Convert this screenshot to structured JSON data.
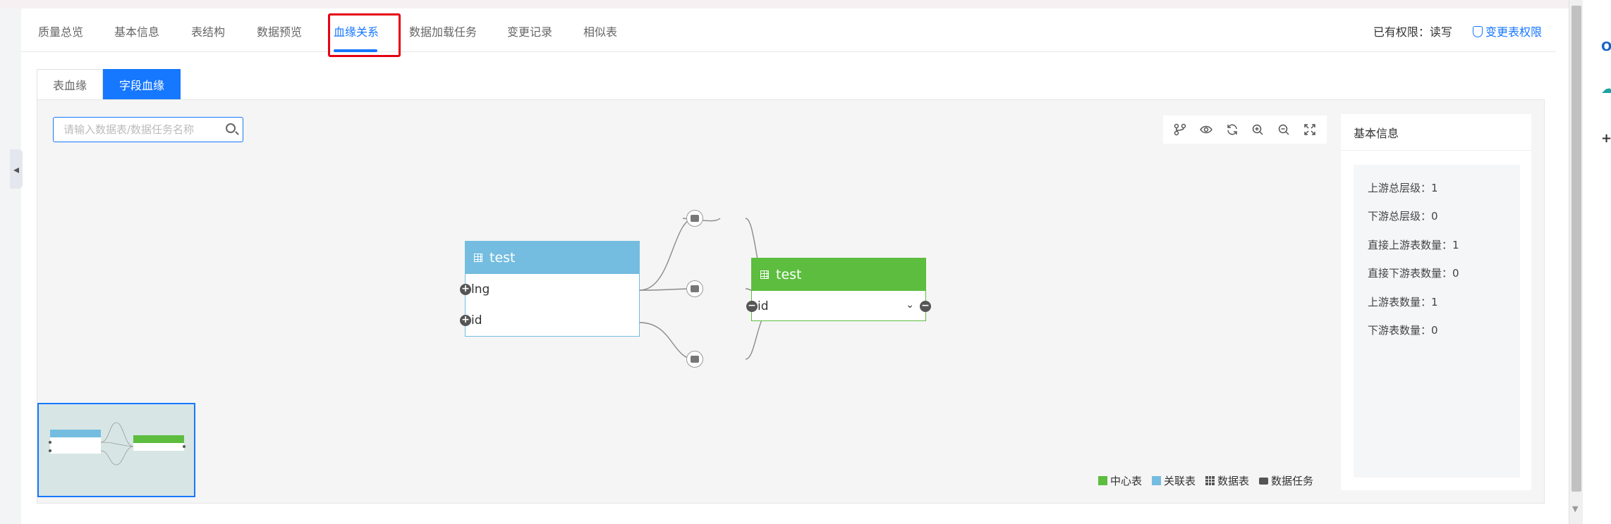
{
  "tabs": [
    "质量总览",
    "基本信息",
    "表结构",
    "数据预览",
    "血缘关系",
    "数据加载任务",
    "变更记录",
    "相似表"
  ],
  "active_tab_index": 4,
  "permission": {
    "label": "已有权限：读写",
    "link": "变更表权限",
    "icon": "shield-icon"
  },
  "subtabs": [
    "表血缘",
    "字段血缘"
  ],
  "active_subtab_index": 1,
  "search": {
    "placeholder": "请输入数据表/数据任务名称",
    "value": ""
  },
  "toolbar_icons": [
    "branch-icon",
    "eye-icon",
    "refresh-icon",
    "zoom-in-icon",
    "zoom-out-icon",
    "fullscreen-icon"
  ],
  "graph": {
    "source_table": {
      "name": "test",
      "fields": [
        "lng",
        "id"
      ],
      "color": "#74bde0"
    },
    "target_table": {
      "name": "test",
      "fields": [
        "id"
      ],
      "color": "#5cbd3e"
    },
    "task_node_icon": "database-task-icon"
  },
  "legend": [
    {
      "label": "中心表",
      "color": "#5cbd3e"
    },
    {
      "label": "关联表",
      "color": "#74bde0"
    },
    {
      "label": "数据表",
      "icon": "table-icon"
    },
    {
      "label": "数据任务",
      "icon": "task-icon"
    }
  ],
  "info": {
    "title": "基本信息",
    "rows": [
      "上游总层级：1",
      "下游总层级：0",
      "直接上游表数量：1",
      "直接下游表数量：0",
      "上游表数量：1",
      "下游表数量：0"
    ]
  }
}
